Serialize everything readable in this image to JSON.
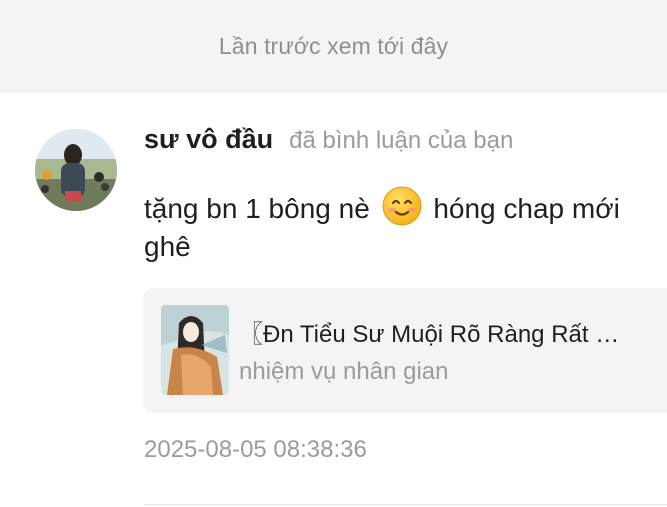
{
  "last_seen": {
    "text": "Lần trước xem tới đây"
  },
  "comment_item": {
    "username": "sư vô đầu",
    "action": "đã bình luận của bạn",
    "text_before_emoji": "tặng bn 1 bông nè ",
    "emoji_icon": "smiling-face-emoji-icon",
    "text_after_emoji": " hóng chap mới",
    "text_line2": "ghê",
    "timestamp": "2025-08-05 08:38:36"
  },
  "story_card": {
    "title": "〖Đn Tiểu Sư Muội Rõ Ràng Rất …",
    "subtitle": "nhiệm vụ nhân gian"
  },
  "colors": {
    "bar_bg": "#f4f4f5",
    "text_primary": "#1f1f1f",
    "text_secondary": "#9b9b9b"
  }
}
